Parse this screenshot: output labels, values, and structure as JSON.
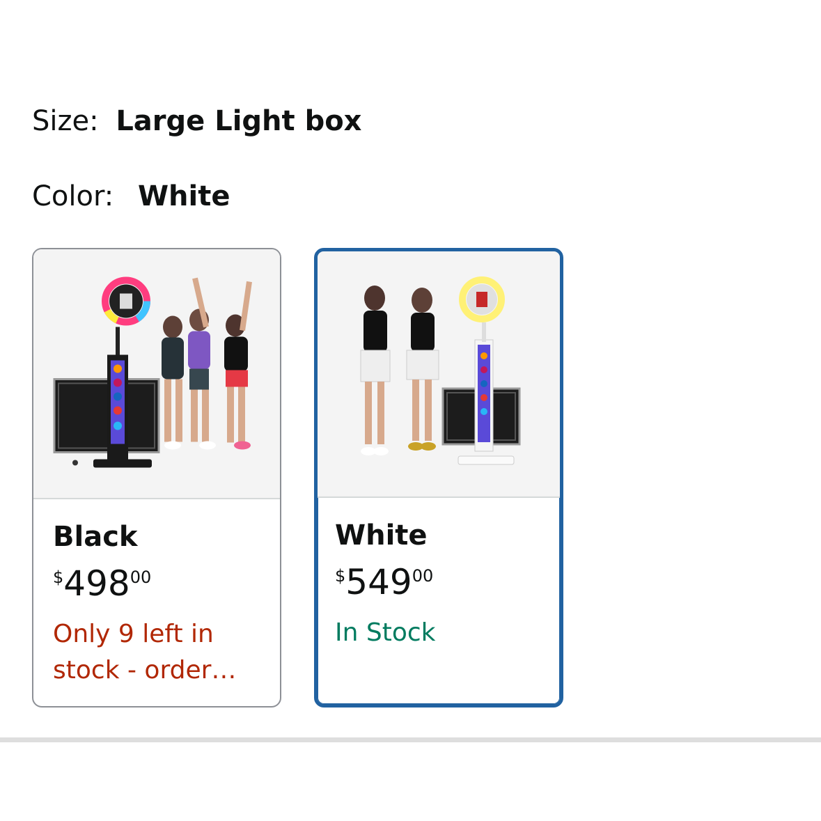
{
  "size": {
    "label": "Size:",
    "value": "Large Light box"
  },
  "color": {
    "label": "Color:",
    "value": "White"
  },
  "swatches": [
    {
      "name": "Black",
      "price_symbol": "$",
      "price_whole": "498",
      "price_fraction": "00",
      "availability": "Only 9 left in stock - order…",
      "availability_color": "#b12704",
      "selected": false,
      "image_icon": "photo-booth-black-image-icon"
    },
    {
      "name": "White",
      "price_symbol": "$",
      "price_whole": "549",
      "price_fraction": "00",
      "availability": "In Stock",
      "availability_color": "#007b5f",
      "selected": true,
      "image_icon": "photo-booth-white-image-icon"
    }
  ],
  "colors": {
    "selected_border": "#2162a1",
    "unselected_border": "#8d9096"
  }
}
